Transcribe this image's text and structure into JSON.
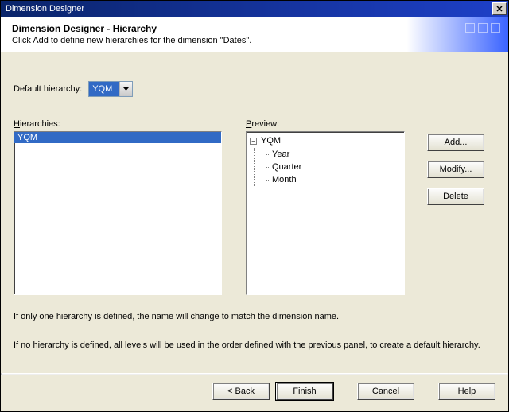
{
  "window": {
    "title": "Dimension Designer"
  },
  "header": {
    "title": "Dimension Designer - Hierarchy",
    "subtitle": "Click Add to define new hierarchies for the dimension \"Dates\"."
  },
  "default_hierarchy": {
    "label": "Default hierarchy:",
    "value": "YQM"
  },
  "hierarchies": {
    "label": "Hierarchies:",
    "items": [
      {
        "name": "YQM",
        "selected": true
      }
    ]
  },
  "preview": {
    "label": "Preview:",
    "root": "YQM",
    "levels": [
      "Year",
      "Quarter",
      "Month"
    ]
  },
  "side_buttons": {
    "add": "Add...",
    "modify": "Modify...",
    "delete": "Delete"
  },
  "notes": {
    "line1": "If only one hierarchy is defined, the name will change to match the dimension name.",
    "line2": "If no hierarchy is defined, all levels will be used in the order defined with the previous panel, to create a default hierarchy."
  },
  "footer": {
    "back": "< Back",
    "finish": "Finish",
    "cancel": "Cancel",
    "help": "Help"
  }
}
